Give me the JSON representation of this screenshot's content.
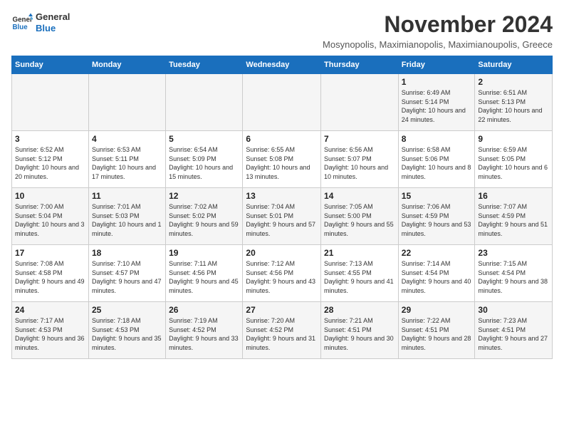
{
  "logo": {
    "line1": "General",
    "line2": "Blue"
  },
  "title": "November 2024",
  "location": "Mosynopolis, Maximianopolis, Maximianoupolis, Greece",
  "days_of_week": [
    "Sunday",
    "Monday",
    "Tuesday",
    "Wednesday",
    "Thursday",
    "Friday",
    "Saturday"
  ],
  "weeks": [
    [
      {
        "day": "",
        "info": ""
      },
      {
        "day": "",
        "info": ""
      },
      {
        "day": "",
        "info": ""
      },
      {
        "day": "",
        "info": ""
      },
      {
        "day": "",
        "info": ""
      },
      {
        "day": "1",
        "info": "Sunrise: 6:49 AM\nSunset: 5:14 PM\nDaylight: 10 hours and 24 minutes."
      },
      {
        "day": "2",
        "info": "Sunrise: 6:51 AM\nSunset: 5:13 PM\nDaylight: 10 hours and 22 minutes."
      }
    ],
    [
      {
        "day": "3",
        "info": "Sunrise: 6:52 AM\nSunset: 5:12 PM\nDaylight: 10 hours and 20 minutes."
      },
      {
        "day": "4",
        "info": "Sunrise: 6:53 AM\nSunset: 5:11 PM\nDaylight: 10 hours and 17 minutes."
      },
      {
        "day": "5",
        "info": "Sunrise: 6:54 AM\nSunset: 5:09 PM\nDaylight: 10 hours and 15 minutes."
      },
      {
        "day": "6",
        "info": "Sunrise: 6:55 AM\nSunset: 5:08 PM\nDaylight: 10 hours and 13 minutes."
      },
      {
        "day": "7",
        "info": "Sunrise: 6:56 AM\nSunset: 5:07 PM\nDaylight: 10 hours and 10 minutes."
      },
      {
        "day": "8",
        "info": "Sunrise: 6:58 AM\nSunset: 5:06 PM\nDaylight: 10 hours and 8 minutes."
      },
      {
        "day": "9",
        "info": "Sunrise: 6:59 AM\nSunset: 5:05 PM\nDaylight: 10 hours and 6 minutes."
      }
    ],
    [
      {
        "day": "10",
        "info": "Sunrise: 7:00 AM\nSunset: 5:04 PM\nDaylight: 10 hours and 3 minutes."
      },
      {
        "day": "11",
        "info": "Sunrise: 7:01 AM\nSunset: 5:03 PM\nDaylight: 10 hours and 1 minute."
      },
      {
        "day": "12",
        "info": "Sunrise: 7:02 AM\nSunset: 5:02 PM\nDaylight: 9 hours and 59 minutes."
      },
      {
        "day": "13",
        "info": "Sunrise: 7:04 AM\nSunset: 5:01 PM\nDaylight: 9 hours and 57 minutes."
      },
      {
        "day": "14",
        "info": "Sunrise: 7:05 AM\nSunset: 5:00 PM\nDaylight: 9 hours and 55 minutes."
      },
      {
        "day": "15",
        "info": "Sunrise: 7:06 AM\nSunset: 4:59 PM\nDaylight: 9 hours and 53 minutes."
      },
      {
        "day": "16",
        "info": "Sunrise: 7:07 AM\nSunset: 4:59 PM\nDaylight: 9 hours and 51 minutes."
      }
    ],
    [
      {
        "day": "17",
        "info": "Sunrise: 7:08 AM\nSunset: 4:58 PM\nDaylight: 9 hours and 49 minutes."
      },
      {
        "day": "18",
        "info": "Sunrise: 7:10 AM\nSunset: 4:57 PM\nDaylight: 9 hours and 47 minutes."
      },
      {
        "day": "19",
        "info": "Sunrise: 7:11 AM\nSunset: 4:56 PM\nDaylight: 9 hours and 45 minutes."
      },
      {
        "day": "20",
        "info": "Sunrise: 7:12 AM\nSunset: 4:56 PM\nDaylight: 9 hours and 43 minutes."
      },
      {
        "day": "21",
        "info": "Sunrise: 7:13 AM\nSunset: 4:55 PM\nDaylight: 9 hours and 41 minutes."
      },
      {
        "day": "22",
        "info": "Sunrise: 7:14 AM\nSunset: 4:54 PM\nDaylight: 9 hours and 40 minutes."
      },
      {
        "day": "23",
        "info": "Sunrise: 7:15 AM\nSunset: 4:54 PM\nDaylight: 9 hours and 38 minutes."
      }
    ],
    [
      {
        "day": "24",
        "info": "Sunrise: 7:17 AM\nSunset: 4:53 PM\nDaylight: 9 hours and 36 minutes."
      },
      {
        "day": "25",
        "info": "Sunrise: 7:18 AM\nSunset: 4:53 PM\nDaylight: 9 hours and 35 minutes."
      },
      {
        "day": "26",
        "info": "Sunrise: 7:19 AM\nSunset: 4:52 PM\nDaylight: 9 hours and 33 minutes."
      },
      {
        "day": "27",
        "info": "Sunrise: 7:20 AM\nSunset: 4:52 PM\nDaylight: 9 hours and 31 minutes."
      },
      {
        "day": "28",
        "info": "Sunrise: 7:21 AM\nSunset: 4:51 PM\nDaylight: 9 hours and 30 minutes."
      },
      {
        "day": "29",
        "info": "Sunrise: 7:22 AM\nSunset: 4:51 PM\nDaylight: 9 hours and 28 minutes."
      },
      {
        "day": "30",
        "info": "Sunrise: 7:23 AM\nSunset: 4:51 PM\nDaylight: 9 hours and 27 minutes."
      }
    ]
  ]
}
